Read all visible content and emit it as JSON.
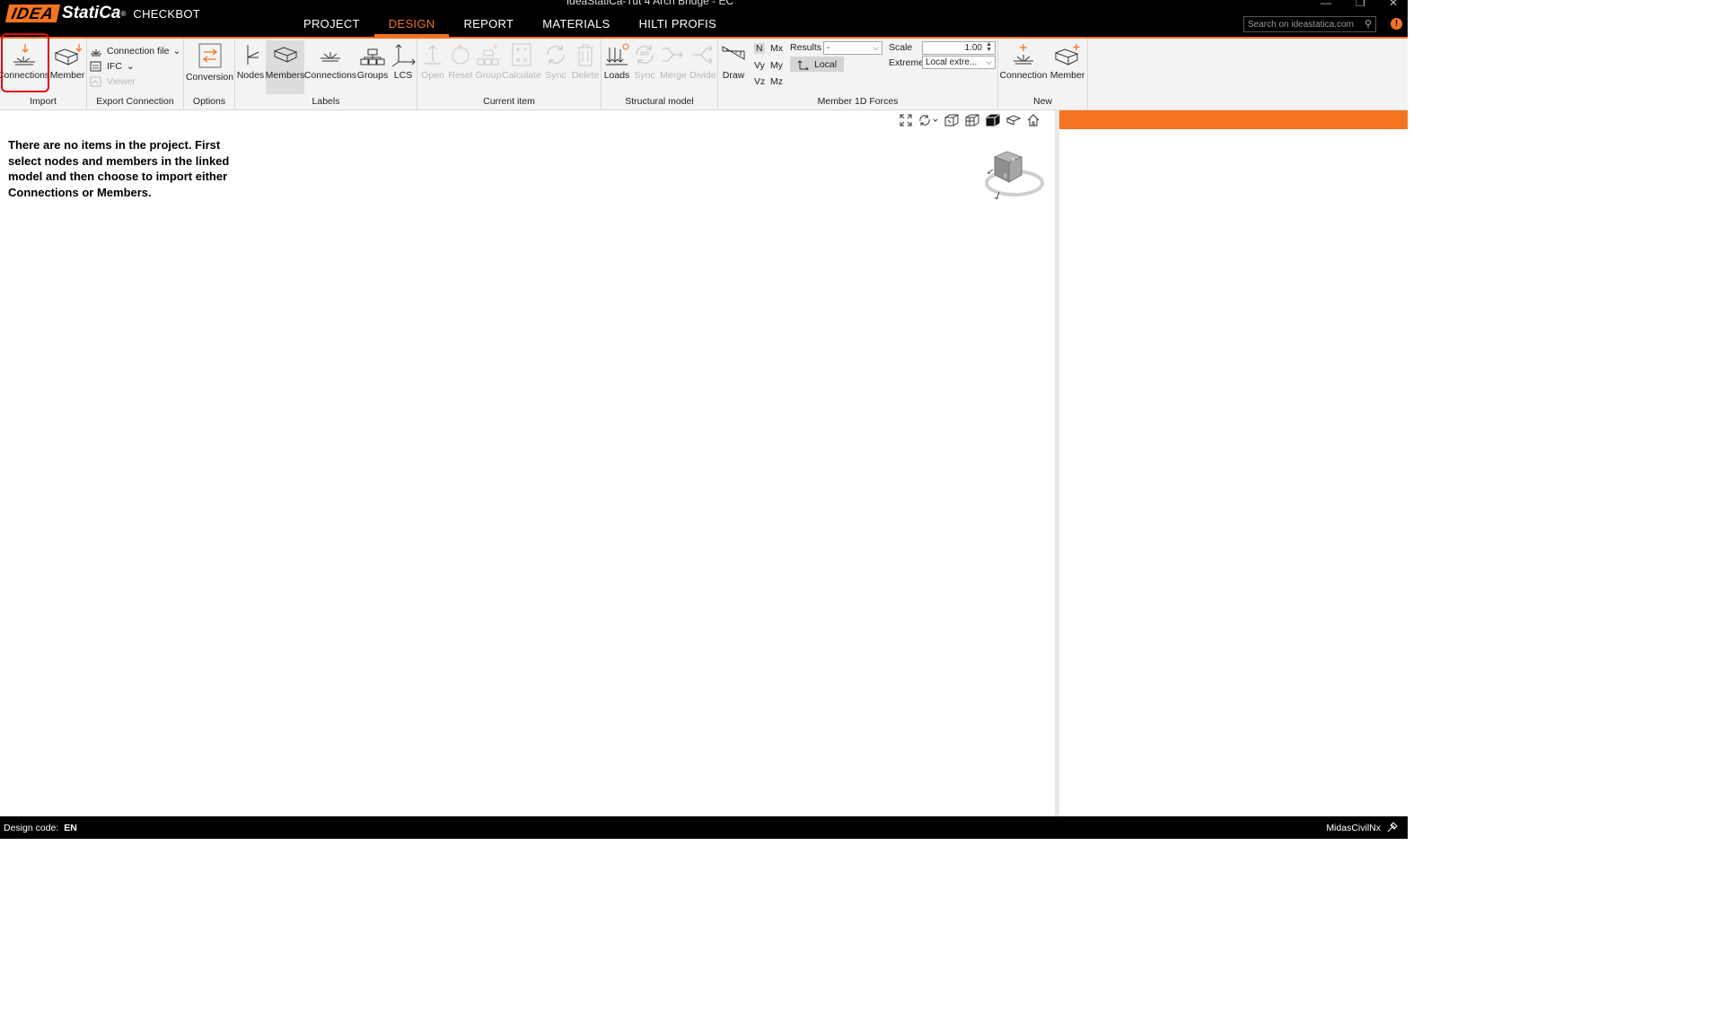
{
  "window": {
    "title": "IdeaStatiCa-Tut 4 Arch Bridge - EC",
    "logo_idea": "IDEA",
    "logo_statica": "StatiCa",
    "logo_reg": "®",
    "product": "CHECKBOT"
  },
  "main_tabs": [
    {
      "label": "PROJECT"
    },
    {
      "label": "DESIGN",
      "active": true
    },
    {
      "label": "REPORT"
    },
    {
      "label": "MATERIALS"
    },
    {
      "label": "HILTI PROFIS"
    }
  ],
  "search": {
    "placeholder": "Search on ideastatica.com"
  },
  "accent_color": "#f37321",
  "ribbon": {
    "import": {
      "label": "Import",
      "connections": "Connections",
      "member": "Member"
    },
    "export": {
      "label": "Export Connection",
      "connection_file": "Connection file",
      "ifc": "IFC",
      "viewer": "Viewer"
    },
    "options": {
      "label": "Options",
      "conversion": "Conversion"
    },
    "labels": {
      "label": "Labels",
      "nodes": "Nodes",
      "members": "Members",
      "connections": "Connections",
      "groups": "Groups",
      "lcs": "LCS"
    },
    "current_item": {
      "label": "Current item",
      "open": "Open",
      "reset": "Reset",
      "group": "Group",
      "calculate": "Calculate",
      "sync": "Sync",
      "delete": "Delete"
    },
    "structural_model": {
      "label": "Structural model",
      "loads": "Loads",
      "sync": "Sync",
      "merge": "Merge",
      "divide": "Divide"
    },
    "member_1d_forces": {
      "label": "Member 1D Forces",
      "draw": "Draw",
      "n": "N",
      "mx": "Mx",
      "vy": "Vy",
      "my": "My",
      "vz": "Vz",
      "mz": "Mz",
      "results_label": "Results",
      "results_value": "-",
      "local": "Local",
      "scale_label": "Scale",
      "scale_value": "1.00",
      "extreme_label": "Extreme",
      "extreme_value": "Local extre..."
    },
    "new": {
      "label": "New",
      "connection": "Connection",
      "member": "Member"
    }
  },
  "content": {
    "empty_message": "There are no items in the project. First select nodes and members in the linked model and then choose to import either Connections or Members."
  },
  "statusbar": {
    "design_code_label": "Design code:",
    "design_code_value": "EN",
    "linked_app": "MidasCivilNx"
  }
}
